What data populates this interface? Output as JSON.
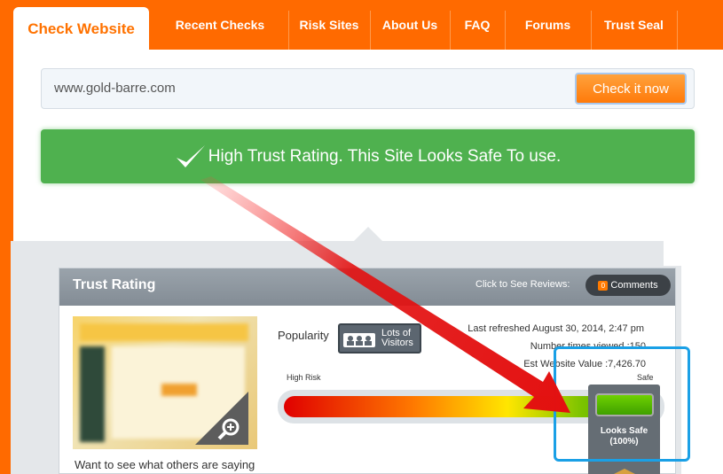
{
  "nav": {
    "active_tab": "Check Website",
    "tabs": [
      "Recent Checks",
      "Risk Sites",
      "About Us",
      "FAQ",
      "Forums",
      "Trust Seal"
    ]
  },
  "search": {
    "value": "www.gold-barre.com",
    "button": "Check it now"
  },
  "banner": {
    "text": "High Trust Rating. This Site Looks Safe To use."
  },
  "trust_card": {
    "title": "Trust Rating",
    "reviews_label": "Click to See Reviews:",
    "comments_count": "0",
    "comments_label": "Comments",
    "popularity_label": "Popularity",
    "visitors_badge_line1": "Lots of",
    "visitors_badge_line2": "Visitors",
    "last_refreshed": "Last refreshed August 30, 2014, 2:47 pm",
    "times_viewed": "Number times viewed :150",
    "website_value": "Est Website Value :7,426.70",
    "high_risk_label": "High Risk",
    "safe_label": "Safe",
    "indicator_line1": "Looks Safe",
    "indicator_line2": "(100%)",
    "thumbnail_caption": "Want to see what others are saying"
  },
  "colors": {
    "brand": "#ff6a00",
    "safe_green": "#4fb14f",
    "highlight": "#1aa0e6",
    "arrow": "#e31010"
  },
  "icons": [
    "checkmark-icon",
    "magnifier-icon",
    "visitors-icon",
    "comment-icon",
    "arrow-annotation"
  ]
}
